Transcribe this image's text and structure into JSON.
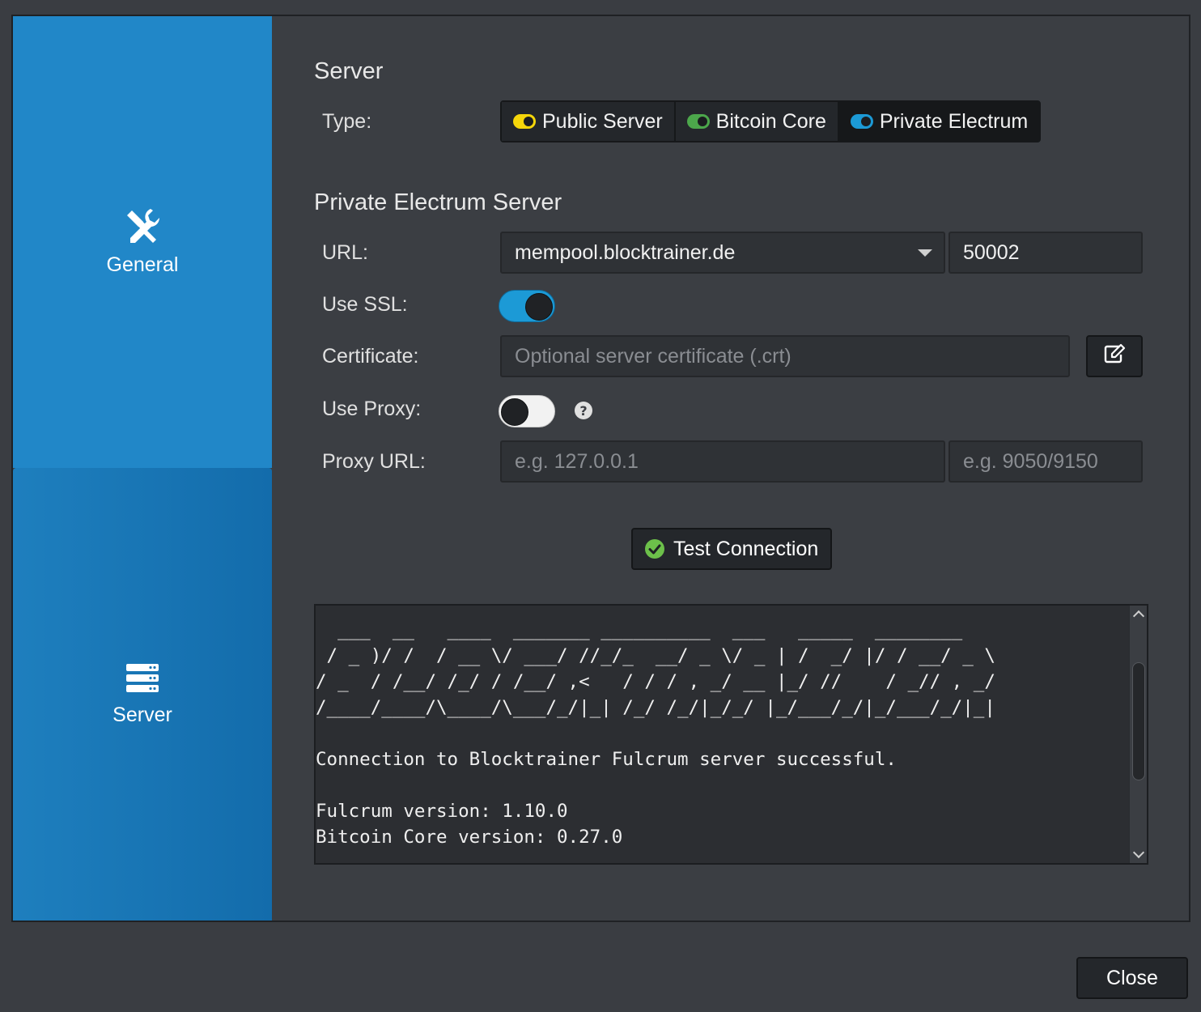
{
  "sidebar": {
    "items": [
      {
        "label": "General",
        "icon": "tools-icon"
      },
      {
        "label": "Server",
        "icon": "server-icon"
      }
    ]
  },
  "server_section": {
    "title": "Server",
    "type_label": "Type:",
    "types": [
      {
        "label": "Public Server",
        "color": "#f5d60a"
      },
      {
        "label": "Bitcoin Core",
        "color": "#4ca74b"
      },
      {
        "label": "Private Electrum",
        "color": "#1c9ad6"
      }
    ],
    "selected_type": "Private Electrum"
  },
  "electrum_section": {
    "title": "Private Electrum Server",
    "url_label": "URL:",
    "url_value": "mempool.blocktrainer.de",
    "port_value": "50002",
    "ssl_label": "Use SSL:",
    "ssl_enabled": true,
    "certificate_label": "Certificate:",
    "certificate_placeholder": "Optional server certificate (.crt)",
    "proxy_label": "Use Proxy:",
    "proxy_enabled": false,
    "proxy_url_label": "Proxy URL:",
    "proxy_host_placeholder": "e.g. 127.0.0.1",
    "proxy_port_placeholder": "e.g. 9050/9150"
  },
  "test_button": {
    "label": "Test Connection"
  },
  "console": {
    "text": "  ___  __   ____  _______ __________  ___   _____  ________\n / _ )/ /  / __ \\/ ___/ //_/_  __/ _ \\/ _ | /  _/ |/ / __/ _ \\\n/ _  / /__/ /_/ / /__/ ,<   / / / , _/ __ |_/ //    / _// , _/\n/____/____/\\____/\\___/_/|_| /_/ /_/|_/_/ |_/___/_/|_/___/_/|_|\n\nConnection to Blocktrainer Fulcrum server successful.\n\nFulcrum version: 1.10.0\nBitcoin Core version: 0.27.0"
  },
  "footer": {
    "close_label": "Close"
  },
  "colors": {
    "sidebar_accent": "#2187c8",
    "toggle_on": "#1c9ad6",
    "check_green": "#6cc04a"
  }
}
